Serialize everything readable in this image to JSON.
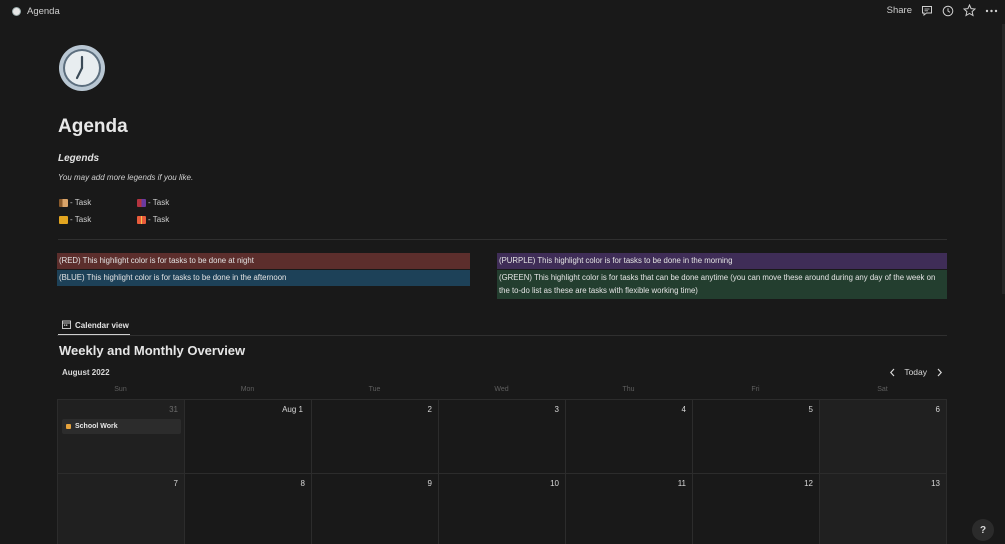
{
  "topbar": {
    "breadcrumb": "Agenda",
    "share_label": "Share",
    "icons": [
      "comment-icon",
      "clock-history-icon",
      "star-icon",
      "more-icon"
    ]
  },
  "page": {
    "title": "Agenda",
    "icon": "clock-icon"
  },
  "legends": {
    "heading": "Legends",
    "subtitle": "You may add more legends if you like.",
    "items": [
      {
        "label": "- Task",
        "icon": "dog-emoji"
      },
      {
        "label": "- Task",
        "icon": "bags-emoji"
      },
      {
        "label": "- Task",
        "icon": "notebook-emoji"
      },
      {
        "label": "- Task",
        "icon": "gift-emoji"
      }
    ]
  },
  "highlights": {
    "red": "(RED) This highlight color is for tasks to be done at night",
    "blue": "(BLUE) This highlight color is for tasks to be done in the afternoon",
    "purple": "(PURPLE) This highlight color is for tasks to be done in the morning",
    "green": "(GREEN) This highlight color is for tasks that can be done anytime (you can move these around during any day of the week on the to-do list as these are tasks with flexible working time)",
    "colors": {
      "red": "#5c2e2c",
      "blue": "#1d4158",
      "purple": "#3f2d57",
      "green": "#233e2f"
    }
  },
  "view": {
    "tab_label": "Calendar view",
    "title": "Weekly and Monthly Overview",
    "month": "August 2022",
    "today_label": "Today"
  },
  "calendar": {
    "weekdays": [
      "Sun",
      "Mon",
      "Tue",
      "Wed",
      "Thu",
      "Fri",
      "Sat"
    ],
    "week1": [
      "31",
      "Aug 1",
      "2",
      "3",
      "4",
      "5",
      "6"
    ],
    "week2": [
      "7",
      "8",
      "9",
      "10",
      "11",
      "12",
      "13"
    ],
    "event": {
      "title": "School Work",
      "day": "31"
    }
  },
  "help_label": "?"
}
